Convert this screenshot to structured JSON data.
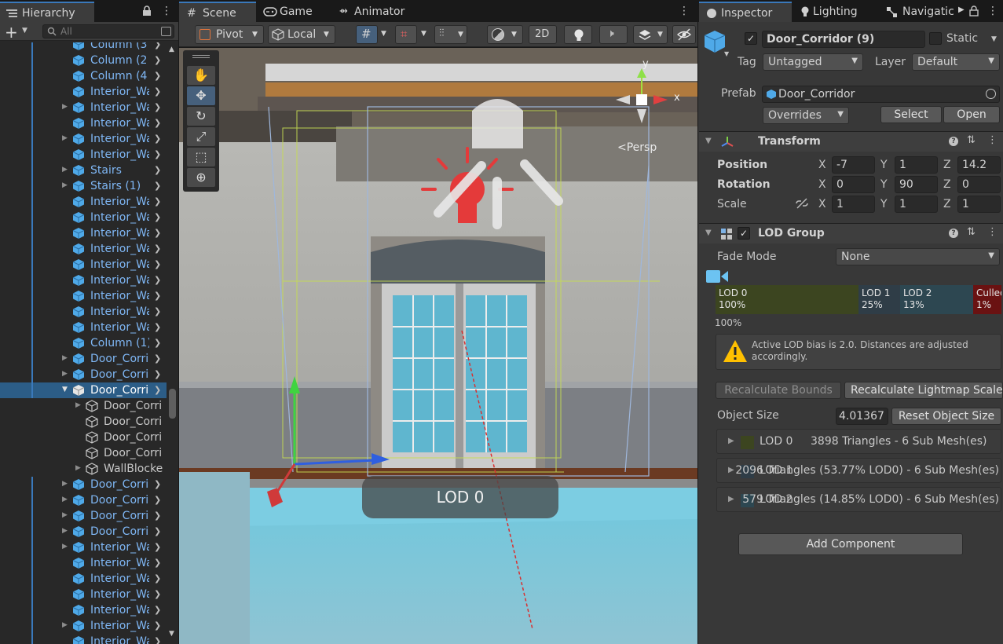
{
  "hierarchy": {
    "tab_label": "Hierarchy",
    "search_placeholder": "All",
    "rows": [
      {
        "name": "Column (3",
        "fold": false,
        "child": false
      },
      {
        "name": "Column (2",
        "fold": false,
        "child": false
      },
      {
        "name": "Column (4",
        "fold": false,
        "child": false
      },
      {
        "name": "Interior_Wa",
        "fold": false,
        "child": false
      },
      {
        "name": "Interior_Wa",
        "fold": true,
        "child": false
      },
      {
        "name": "Interior_Wa",
        "fold": false,
        "child": false
      },
      {
        "name": "Interior_Wa",
        "fold": true,
        "child": false
      },
      {
        "name": "Interior_Wa",
        "fold": false,
        "child": false
      },
      {
        "name": "Stairs",
        "fold": true,
        "child": false
      },
      {
        "name": "Stairs (1)",
        "fold": true,
        "child": false
      },
      {
        "name": "Interior_Wa",
        "fold": false,
        "child": false
      },
      {
        "name": "Interior_Wa",
        "fold": false,
        "child": false
      },
      {
        "name": "Interior_Wa",
        "fold": false,
        "child": false
      },
      {
        "name": "Interior_Wa",
        "fold": false,
        "child": false
      },
      {
        "name": "Interior_Wa",
        "fold": false,
        "child": false
      },
      {
        "name": "Interior_Wa",
        "fold": false,
        "child": false
      },
      {
        "name": "Interior_Wa",
        "fold": false,
        "child": false
      },
      {
        "name": "Interior_Wa",
        "fold": false,
        "child": false
      },
      {
        "name": "Interior_Wa",
        "fold": false,
        "child": false
      },
      {
        "name": "Column (1)",
        "fold": false,
        "child": false
      },
      {
        "name": "Door_Corri",
        "fold": true,
        "child": false
      },
      {
        "name": "Door_Corri",
        "fold": true,
        "child": false
      },
      {
        "name": "Door_Corri",
        "fold": "open",
        "child": false,
        "selected": true
      },
      {
        "name": "Door_Corri",
        "fold": true,
        "child": true
      },
      {
        "name": "Door_Corri",
        "fold": false,
        "child": true
      },
      {
        "name": "Door_Corri",
        "fold": false,
        "child": true
      },
      {
        "name": "Door_Corri",
        "fold": false,
        "child": true
      },
      {
        "name": "WallBlocke",
        "fold": true,
        "child": true
      },
      {
        "name": "Door_Corri",
        "fold": true,
        "child": false
      },
      {
        "name": "Door_Corri",
        "fold": true,
        "child": false
      },
      {
        "name": "Door_Corri",
        "fold": true,
        "child": false
      },
      {
        "name": "Door_Corri",
        "fold": true,
        "child": false
      },
      {
        "name": "Interior_Wa",
        "fold": true,
        "child": false
      },
      {
        "name": "Interior_Wa",
        "fold": false,
        "child": false
      },
      {
        "name": "Interior_Wa",
        "fold": false,
        "child": false
      },
      {
        "name": "Interior_Wa",
        "fold": false,
        "child": false
      },
      {
        "name": "Interior_Wa",
        "fold": false,
        "child": false
      },
      {
        "name": "Interior_Wa",
        "fold": true,
        "child": false
      },
      {
        "name": "Interior_Wa",
        "fold": false,
        "child": false
      }
    ]
  },
  "scene": {
    "tabs": [
      "Scene",
      "Game",
      "Animator"
    ],
    "pivot_label": "Pivot",
    "local_label": "Local",
    "mode_2d": "2D",
    "persp_label": "<Persp",
    "lod_badge": "LOD 0",
    "axis_y": "y",
    "axis_x": "x"
  },
  "inspector": {
    "tabs": [
      "Inspector",
      "Lighting",
      "Navigatic"
    ],
    "object_name": "Door_Corridor (9)",
    "static_label": "Static",
    "tag_label": "Tag",
    "tag_value": "Untagged",
    "layer_label": "Layer",
    "layer_value": "Default",
    "prefab_label": "Prefab",
    "prefab_value": "Door_Corridor",
    "overrides_label": "Overrides",
    "select_label": "Select",
    "open_label": "Open",
    "transform": {
      "title": "Transform",
      "position_label": "Position",
      "rotation_label": "Rotation",
      "scale_label": "Scale",
      "axes": [
        "X",
        "Y",
        "Z"
      ],
      "position": [
        "-7",
        "1",
        "14.2"
      ],
      "rotation": [
        "0",
        "90",
        "0"
      ],
      "scale": [
        "1",
        "1",
        "1"
      ]
    },
    "lod_group": {
      "title": "LOD Group",
      "fade_mode_label": "Fade Mode",
      "fade_mode_value": "None",
      "segments": [
        {
          "name": "LOD 0",
          "pct": "100%",
          "color": "#3c4520"
        },
        {
          "name": "LOD 1",
          "pct": "25%",
          "color": "#2f3d47"
        },
        {
          "name": "LOD 2",
          "pct": "13%",
          "color": "#2d4751"
        },
        {
          "name": "Culled",
          "pct": "1%",
          "color": "#6a1212"
        }
      ],
      "camera_pct": "100%",
      "warning": "Active LOD bias is 2.0. Distances are adjusted accordingly.",
      "recalc_bounds": "Recalculate Bounds",
      "recalc_lightmap": "Recalculate Lightmap Scale",
      "object_size_label": "Object Size",
      "object_size_value": "4.01367",
      "reset_size": "Reset Object Size",
      "lods": [
        {
          "label": "LOD 0",
          "info": "3898 Triangles  - 6 Sub Mesh(es)",
          "swatch": "#3c4520"
        },
        {
          "label": "LOD 1",
          "info": "2096 Triangles (53.77% LOD0) - 6 Sub Mesh(es)",
          "swatch": "#2f3d47"
        },
        {
          "label": "LOD 2",
          "info": "579 Triangles (14.85% LOD0) - 6 Sub Mesh(es)",
          "swatch": "#2d4751"
        }
      ]
    },
    "add_component": "Add Component"
  }
}
